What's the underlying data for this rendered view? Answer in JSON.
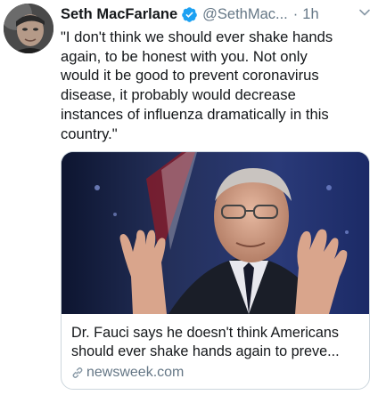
{
  "tweet": {
    "author_name": "Seth MacFarlane",
    "handle": "@SethMac...",
    "separator": "·",
    "time": "1h",
    "text": "\"I don't think we should ever shake hands\nagain, to be honest with you. Not only\nwould it be good to prevent coronavirus\ndisease, it probably would decrease\ninstances of influenza dramatically in this\ncountry.\""
  },
  "card": {
    "title": "Dr. Fauci says he doesn't think Americans should ever shake hands again to preve...",
    "domain": "newsweek.com"
  },
  "icons": {
    "verified": "verified-badge-icon",
    "chevron": "chevron-down-icon",
    "link": "link-icon"
  },
  "colors": {
    "verified_blue": "#1da1f2",
    "secondary_text": "#657786",
    "primary_text": "#14171a",
    "card_border": "#ccd6dd"
  }
}
